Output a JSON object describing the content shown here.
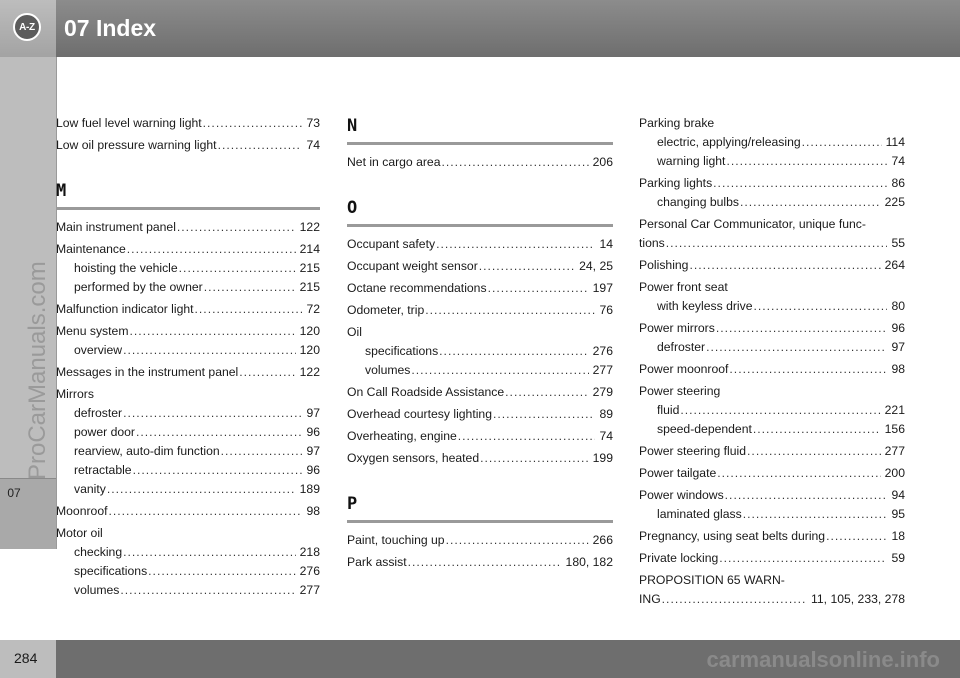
{
  "header": {
    "badge": "A-Z",
    "title": "07 Index"
  },
  "side": {
    "chapter_tab": "07",
    "watermark": "ProCarManuals.com"
  },
  "footer": {
    "page_number": "284",
    "watermark": "carmanualsonline.info"
  },
  "columns": [
    {
      "blocks": [
        {
          "letter": "",
          "entries": [
            {
              "lines": [
                {
                  "text": "Low fuel level warning light",
                  "page": "73"
                }
              ]
            },
            {
              "lines": [
                {
                  "text": "Low oil pressure warning light",
                  "page": "74"
                }
              ]
            }
          ]
        },
        {
          "letter": "M",
          "entries": [
            {
              "lines": [
                {
                  "text": "Main instrument panel",
                  "page": "122"
                }
              ]
            },
            {
              "lines": [
                {
                  "text": "Maintenance",
                  "page": "214"
                },
                {
                  "text": "hoisting the vehicle",
                  "page": "215",
                  "sub": true
                },
                {
                  "text": "performed by the owner",
                  "page": "215",
                  "sub": true
                }
              ]
            },
            {
              "lines": [
                {
                  "text": "Malfunction indicator light",
                  "page": "72"
                }
              ]
            },
            {
              "lines": [
                {
                  "text": "Menu system",
                  "page": "120"
                },
                {
                  "text": "overview",
                  "page": "120",
                  "sub": true
                }
              ]
            },
            {
              "lines": [
                {
                  "text": "Messages in the instrument panel",
                  "page": "122"
                }
              ]
            },
            {
              "lines": [
                {
                  "text": "Mirrors",
                  "page": ""
                },
                {
                  "text": "defroster",
                  "page": "97",
                  "sub": true
                },
                {
                  "text": "power door",
                  "page": "96",
                  "sub": true
                },
                {
                  "text": "rearview, auto-dim function",
                  "page": "97",
                  "sub": true
                },
                {
                  "text": "retractable",
                  "page": "96",
                  "sub": true
                },
                {
                  "text": "vanity",
                  "page": "189",
                  "sub": true
                }
              ]
            },
            {
              "lines": [
                {
                  "text": "Moonroof",
                  "page": "98"
                }
              ]
            },
            {
              "lines": [
                {
                  "text": "Motor oil",
                  "page": ""
                },
                {
                  "text": "checking",
                  "page": "218",
                  "sub": true
                },
                {
                  "text": "specifications",
                  "page": "276",
                  "sub": true
                },
                {
                  "text": "volumes",
                  "page": "277",
                  "sub": true
                }
              ]
            }
          ]
        }
      ]
    },
    {
      "blocks": [
        {
          "letter": "N",
          "entries": [
            {
              "lines": [
                {
                  "text": "Net in cargo area",
                  "page": "206"
                }
              ]
            }
          ]
        },
        {
          "letter": "O",
          "entries": [
            {
              "lines": [
                {
                  "text": "Occupant safety",
                  "page": "14"
                }
              ]
            },
            {
              "lines": [
                {
                  "text": "Occupant weight sensor",
                  "page": "24, 25"
                }
              ]
            },
            {
              "lines": [
                {
                  "text": "Octane recommendations",
                  "page": "197"
                }
              ]
            },
            {
              "lines": [
                {
                  "text": "Odometer, trip",
                  "page": "76"
                }
              ]
            },
            {
              "lines": [
                {
                  "text": "Oil",
                  "page": ""
                },
                {
                  "text": "specifications",
                  "page": "276",
                  "sub": true
                },
                {
                  "text": "volumes",
                  "page": "277",
                  "sub": true
                }
              ]
            },
            {
              "lines": [
                {
                  "text": "On Call Roadside Assistance",
                  "page": "279"
                }
              ]
            },
            {
              "lines": [
                {
                  "text": "Overhead courtesy lighting",
                  "page": "89"
                }
              ]
            },
            {
              "lines": [
                {
                  "text": "Overheating, engine",
                  "page": "74"
                }
              ]
            },
            {
              "lines": [
                {
                  "text": "Oxygen sensors, heated",
                  "page": "199"
                }
              ]
            }
          ]
        },
        {
          "letter": "P",
          "entries": [
            {
              "lines": [
                {
                  "text": "Paint, touching up",
                  "page": "266"
                }
              ]
            },
            {
              "lines": [
                {
                  "text": "Park assist",
                  "page": "180, 182"
                }
              ]
            }
          ]
        }
      ]
    },
    {
      "blocks": [
        {
          "letter": "",
          "entries": [
            {
              "lines": [
                {
                  "text": "Parking brake",
                  "page": ""
                },
                {
                  "text": "electric, applying/releasing",
                  "page": "114",
                  "sub": true
                },
                {
                  "text": "warning light",
                  "page": "74",
                  "sub": true
                }
              ]
            },
            {
              "lines": [
                {
                  "text": "Parking lights",
                  "page": "86"
                },
                {
                  "text": "changing bulbs",
                  "page": "225",
                  "sub": true
                }
              ]
            },
            {
              "lines": [
                {
                  "plain": "Personal Car Communicator, unique func-"
                },
                {
                  "text": "tions",
                  "page": "55"
                }
              ]
            },
            {
              "lines": [
                {
                  "text": "Polishing",
                  "page": "264"
                }
              ]
            },
            {
              "lines": [
                {
                  "text": "Power front seat",
                  "page": ""
                },
                {
                  "text": "with keyless drive",
                  "page": "80",
                  "sub": true
                }
              ]
            },
            {
              "lines": [
                {
                  "text": "Power mirrors",
                  "page": "96"
                },
                {
                  "text": "defroster",
                  "page": "97",
                  "sub": true
                }
              ]
            },
            {
              "lines": [
                {
                  "text": "Power moonroof",
                  "page": "98"
                }
              ]
            },
            {
              "lines": [
                {
                  "text": "Power steering",
                  "page": ""
                },
                {
                  "text": "fluid",
                  "page": "221",
                  "sub": true
                },
                {
                  "text": "speed-dependent",
                  "page": "156",
                  "sub": true
                }
              ]
            },
            {
              "lines": [
                {
                  "text": "Power steering fluid",
                  "page": "277"
                }
              ]
            },
            {
              "lines": [
                {
                  "text": "Power tailgate",
                  "page": "200"
                }
              ]
            },
            {
              "lines": [
                {
                  "text": "Power windows",
                  "page": "94"
                },
                {
                  "text": "laminated glass",
                  "page": "95",
                  "sub": true
                }
              ]
            },
            {
              "lines": [
                {
                  "text": "Pregnancy, using seat belts during",
                  "page": "18"
                }
              ]
            },
            {
              "lines": [
                {
                  "text": "Private locking",
                  "page": "59"
                }
              ]
            },
            {
              "lines": [
                {
                  "plain": "PROPOSITION 65 WARN-"
                },
                {
                  "text": "ING",
                  "page": "11, 105, 233, 278"
                }
              ]
            }
          ]
        }
      ]
    }
  ]
}
